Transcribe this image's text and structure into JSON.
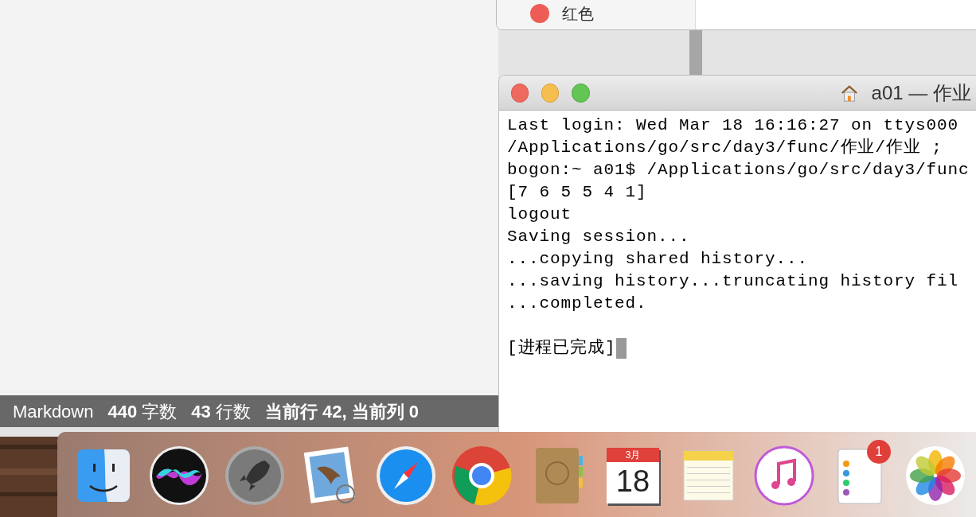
{
  "back_window": {
    "sidebar_item": {
      "label": "红色",
      "color": "#ee5d55"
    }
  },
  "terminal": {
    "title": "a01 — 作业",
    "lines": [
      "Last login: Wed Mar 18 16:16:27 on ttys000",
      "/Applications/go/src/day3/func/作业/作业 ;",
      "bogon:~ a01$ /Applications/go/src/day3/func",
      "[7 6 5 5 4 1]",
      "logout",
      "Saving session...",
      "...copying shared history...",
      "...saving history...truncating history fil",
      "...completed."
    ],
    "status": "[进程已完成]"
  },
  "status_bar": {
    "mode": "Markdown",
    "chars": "440",
    "chars_label": "字数",
    "lines": "43",
    "lines_label": "行数",
    "position": "当前行 42, 当前列 0"
  },
  "dock": [
    {
      "kind": "finder"
    },
    {
      "kind": "siri"
    },
    {
      "kind": "launchpad"
    },
    {
      "kind": "mail"
    },
    {
      "kind": "safari"
    },
    {
      "kind": "chrome"
    },
    {
      "kind": "contacts"
    },
    {
      "kind": "calendar",
      "month": "3月",
      "day": "18"
    },
    {
      "kind": "notes"
    },
    {
      "kind": "itunes"
    },
    {
      "kind": "reminders",
      "badge": "1"
    },
    {
      "kind": "photos"
    }
  ]
}
